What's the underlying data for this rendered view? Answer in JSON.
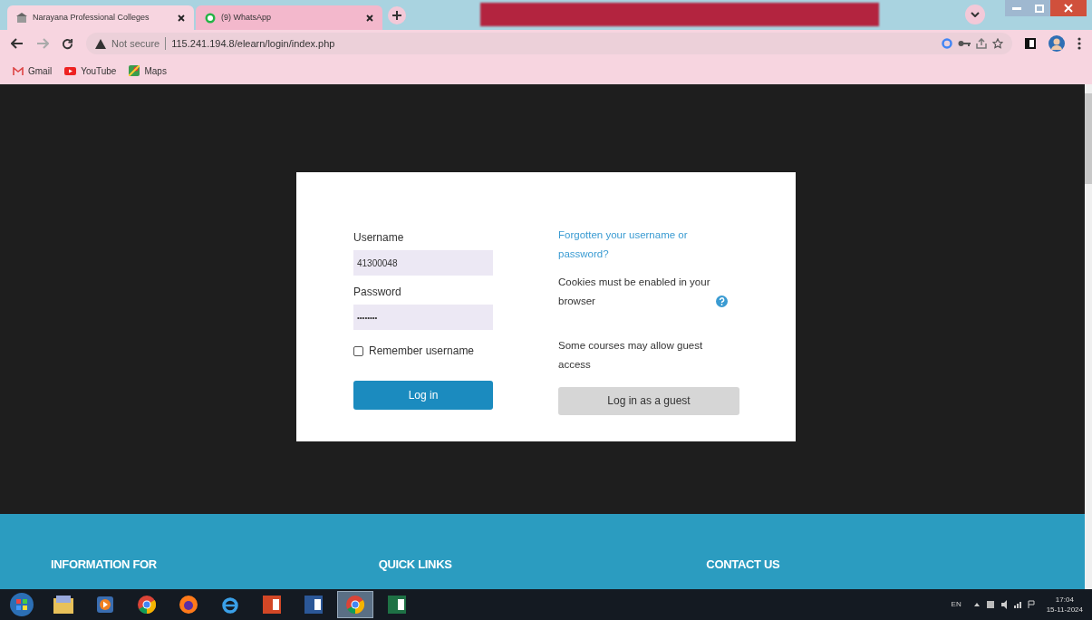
{
  "browser": {
    "tabs": [
      {
        "title": "Narayana Professional Colleges",
        "selected": true
      },
      {
        "title": "(9) WhatsApp",
        "selected": false
      }
    ],
    "address": {
      "warning": "Not secure",
      "url": "115.241.194.8/elearn/login/index.php"
    },
    "bookmarks": [
      {
        "label": "Gmail"
      },
      {
        "label": "YouTube"
      },
      {
        "label": "Maps"
      }
    ]
  },
  "login": {
    "username_label": "Username",
    "username_value": "41300048",
    "password_label": "Password",
    "password_value": "••••••••",
    "remember": {
      "label": "Remember username",
      "checked": false
    },
    "login_button": "Log in",
    "forgot_link": "Forgotten your username or password?",
    "cookies_note": "Cookies must be enabled in your browser",
    "guest_note": "Some courses may allow guest access",
    "guest_button": "Log in as a guest"
  },
  "footer": {
    "headings": [
      "INFORMATION FOR",
      "QUICK LINKS",
      "CONTACT US"
    ]
  },
  "taskbar": {
    "apps": [
      {
        "kind": "explorer",
        "active": false
      },
      {
        "kind": "media",
        "active": false
      },
      {
        "kind": "chrome",
        "active": false
      },
      {
        "kind": "firefox",
        "active": false
      },
      {
        "kind": "ie",
        "active": false
      },
      {
        "kind": "powerpoint",
        "active": false
      },
      {
        "kind": "word",
        "active": false
      },
      {
        "kind": "chrome",
        "active": true
      },
      {
        "kind": "excel",
        "active": false
      }
    ],
    "language": "EN",
    "time": "17:04",
    "date": "15-11-2024"
  }
}
